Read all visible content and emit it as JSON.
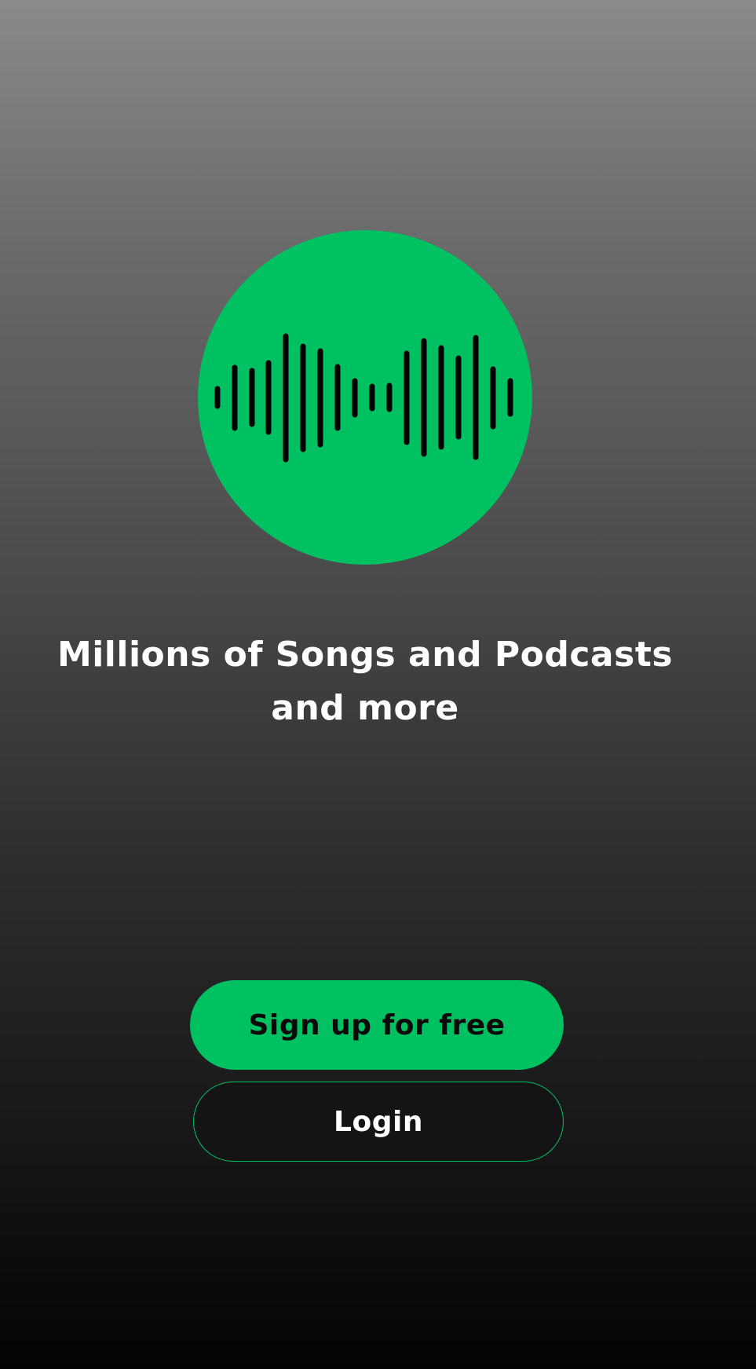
{
  "headline": {
    "line1": "Millions of Songs and Podcasts",
    "line2": "and more"
  },
  "buttons": {
    "signup_label": "Sign up for free",
    "login_label": "Login"
  },
  "logo": {
    "icon": "soundwave-icon",
    "circle_color": "#00c162",
    "bar_color": "#000000"
  },
  "colors": {
    "accent": "#00c162",
    "text": "#ffffff",
    "background_top": "#8a8a8a",
    "background_bottom": "#030303"
  }
}
